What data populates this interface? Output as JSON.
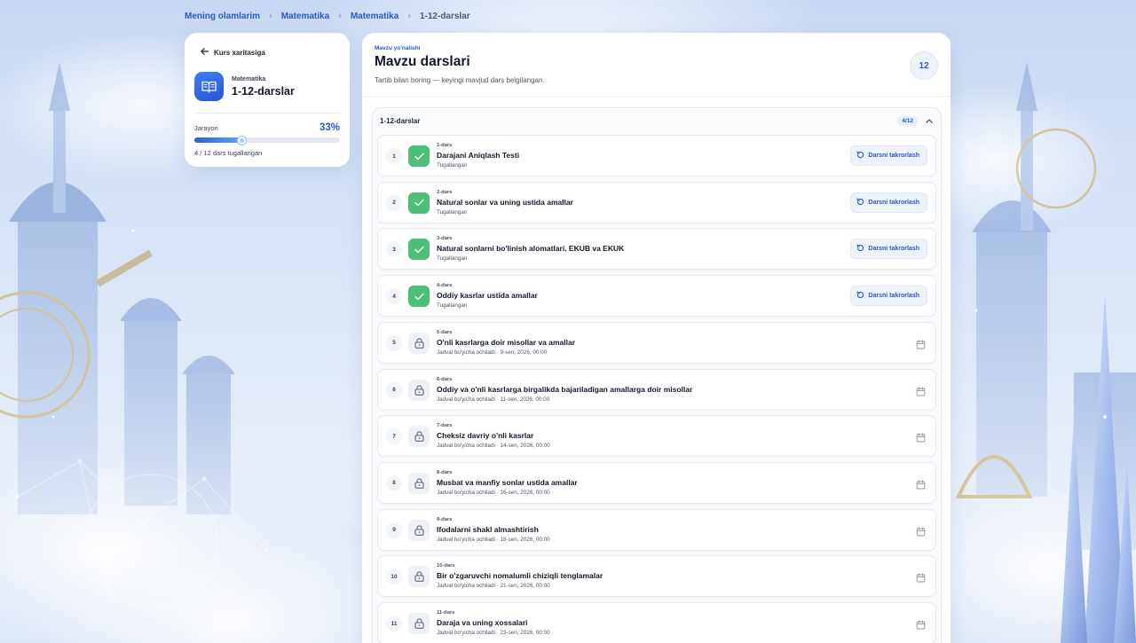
{
  "breadcrumb": {
    "items": [
      "Mening olamlarim",
      "Matematika",
      "Matematika"
    ],
    "current": "1-12-darslar"
  },
  "sidebar": {
    "back_label": "Kurs xaritasiga",
    "course_subject": "Matematika",
    "course_title": "1-12-darslar",
    "progress_label": "Jarayon",
    "progress_percent": "33%",
    "progress_fraction": 0.33,
    "progress_note": "4 / 12 dars tugallangan"
  },
  "main": {
    "eyebrow": "Mavzu yo'nalishi",
    "title": "Mavzu darslari",
    "description": "Tartib bilan boring — keyingi mavjud dars belgilangan.",
    "total_badge": "12",
    "section": {
      "title": "1-12-darslar",
      "count": "4/12"
    },
    "repeat_label": "Darsni takrorlash",
    "lessons": [
      {
        "num": "1",
        "tag": "1-dars",
        "title": "Darajani Aniqlash Testi",
        "sub": "Tugallangan",
        "status": "done"
      },
      {
        "num": "2",
        "tag": "2-dars",
        "title": "Natural sonlar va uning ustida amallar",
        "sub": "Tugallangan",
        "status": "done"
      },
      {
        "num": "3",
        "tag": "3-dars",
        "title": "Natural sonlarni bo'linish alomatlari. EKUB va EKUK",
        "sub": "Tugallangan",
        "status": "done"
      },
      {
        "num": "4",
        "tag": "4-dars",
        "title": "Oddiy kasrlar ustida amallar",
        "sub": "Tugallangan",
        "status": "done"
      },
      {
        "num": "5",
        "tag": "5-dars",
        "title": "O'nli kasrlarga doir misollar va amallar",
        "sub": "Jadval bo'yicha ochiladi · 9-sen, 2026, 00:00",
        "status": "locked"
      },
      {
        "num": "6",
        "tag": "6-dars",
        "title": "Oddiy va o'nli kasrlarga birgalikda bajariladigan amallarga doir misollar",
        "sub": "Jadval bo'yicha ochiladi · 11-sen, 2026, 00:00",
        "status": "locked"
      },
      {
        "num": "7",
        "tag": "7-dars",
        "title": "Cheksiz davriy o'nli kasrlar",
        "sub": "Jadval bo'yicha ochiladi · 14-sen, 2026, 00:00",
        "status": "locked"
      },
      {
        "num": "8",
        "tag": "8-dars",
        "title": "Musbat va manfiy sonlar ustida amallar",
        "sub": "Jadval bo'yicha ochiladi · 16-sen, 2026, 00:00",
        "status": "locked"
      },
      {
        "num": "9",
        "tag": "9-dars",
        "title": "Ifodalarni shakl almashtirish",
        "sub": "Jadval bo'yicha ochiladi · 18-sen, 2026, 00:00",
        "status": "locked"
      },
      {
        "num": "10",
        "tag": "10-dars",
        "title": "Bir o'zgaruvchi nomalumli chiziqli tenglamalar",
        "sub": "Jadval bo'yicha ochiladi · 21-sen, 2026, 00:00",
        "status": "locked"
      },
      {
        "num": "11",
        "tag": "11-dars",
        "title": "Daraja va uning xossalari",
        "sub": "Jadval bo'yicha ochiladi · 23-sen, 2026, 00:00",
        "status": "locked"
      }
    ]
  },
  "icons": {
    "back": "arrow-left-icon",
    "course": "book-open-icon",
    "collapse": "chevron-up-icon",
    "done": "check-icon",
    "locked": "lock-icon",
    "repeat": "rotate-ccw-icon",
    "schedule": "calendar-icon"
  },
  "colors": {
    "accent": "#2a57c9",
    "done": "#4ebf78"
  }
}
